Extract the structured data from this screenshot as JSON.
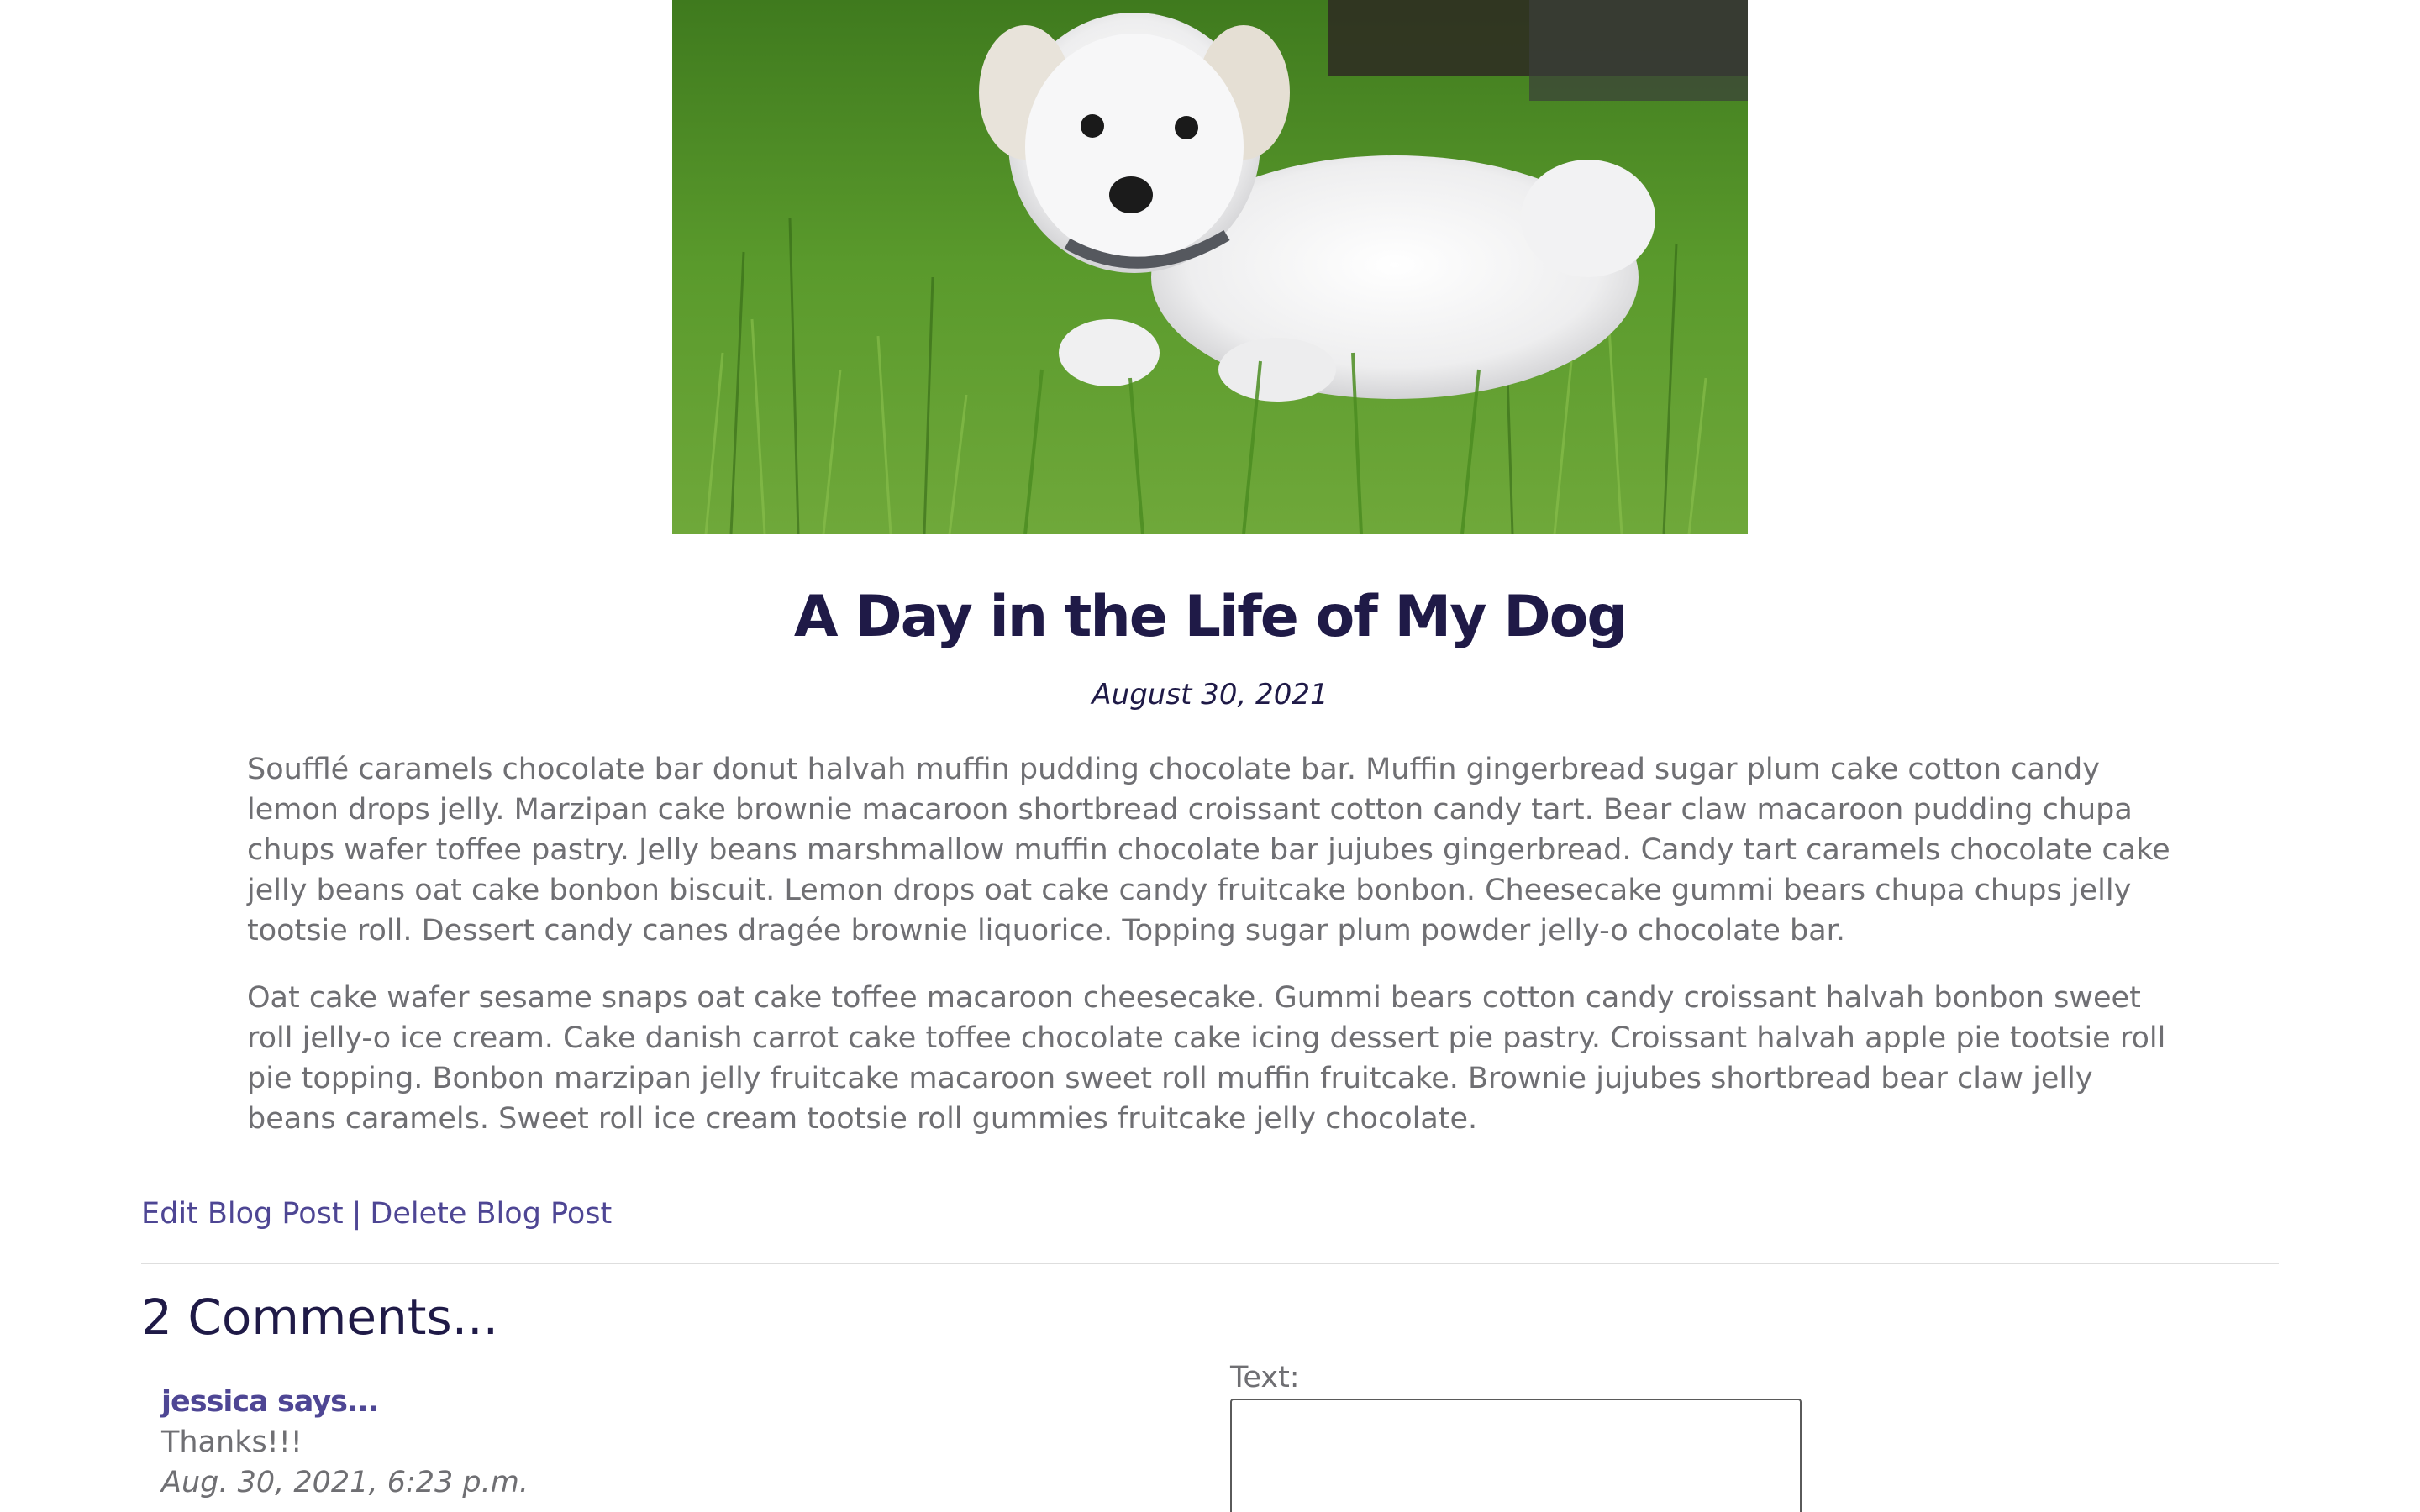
{
  "post": {
    "image_alt": "White dog lying in green grass",
    "title": "A Day in the Life of My Dog",
    "date": "August 30, 2021",
    "paragraphs": [
      "Soufflé caramels chocolate bar donut halvah muffin pudding chocolate bar. Muffin gingerbread sugar plum cake cotton candy lemon drops jelly. Marzipan cake brownie macaroon shortbread croissant cotton candy tart. Bear claw macaroon pudding chupa chups wafer toffee pastry. Jelly beans marshmallow muffin chocolate bar jujubes gingerbread. Candy tart caramels chocolate cake jelly beans oat cake bonbon biscuit. Lemon drops oat cake candy fruitcake bonbon. Cheesecake gummi bears chupa chups jelly tootsie roll. Dessert candy canes dragée brownie liquorice. Topping sugar plum powder jelly-o chocolate bar.",
      "Oat cake wafer sesame snaps oat cake toffee macaroon cheesecake. Gummi bears cotton candy croissant halvah bonbon sweet roll jelly-o ice cream. Cake danish carrot cake toffee chocolate cake icing dessert pie pastry. Croissant halvah apple pie tootsie roll pie topping. Bonbon marzipan jelly fruitcake macaroon sweet roll muffin fruitcake. Brownie jujubes shortbread bear claw jelly beans caramels. Sweet roll ice cream tootsie roll gummies fruitcake jelly chocolate."
    ]
  },
  "actions": {
    "edit_label": "Edit Blog Post",
    "separator": "|",
    "delete_label": "Delete Blog Post"
  },
  "comments": {
    "heading": "2 Comments...",
    "items": [
      {
        "author": "jessica says...",
        "text": "Thanks!!!",
        "time": "Aug. 30, 2021, 6:23 p.m."
      }
    ]
  },
  "form": {
    "text_label": "Text:",
    "text_value": ""
  },
  "colors": {
    "title": "#1f1a47",
    "link": "#4e4694",
    "body_text": "#6f6f73",
    "divider": "#dedede"
  }
}
